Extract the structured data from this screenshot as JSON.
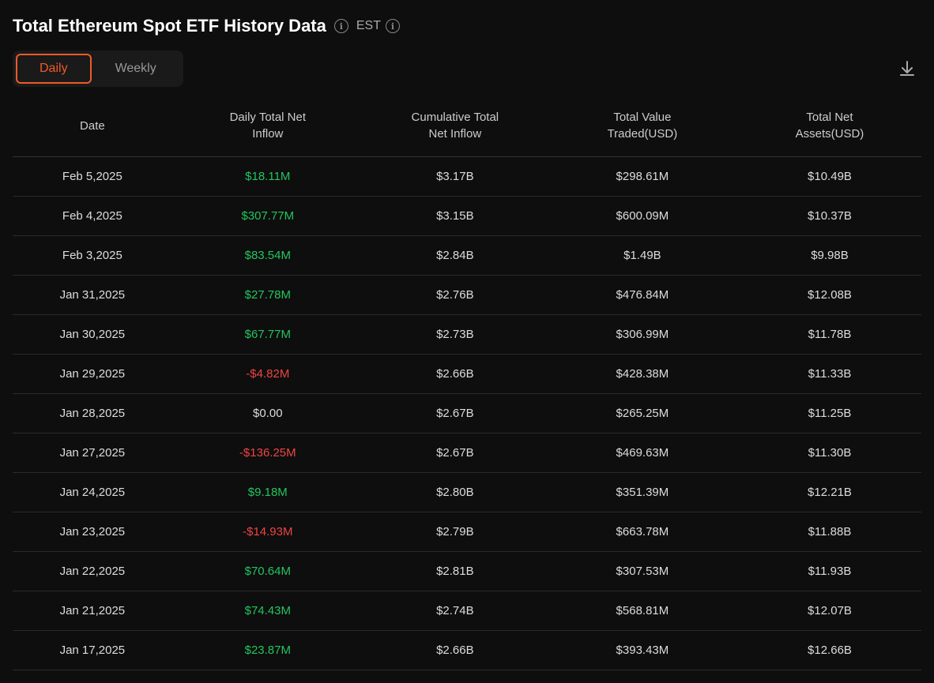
{
  "title": "Total Ethereum Spot ETF History Data",
  "timezone": "EST",
  "tabs": [
    {
      "label": "Daily",
      "active": true
    },
    {
      "label": "Weekly",
      "active": false
    }
  ],
  "columns": [
    {
      "key": "date",
      "label": "Date"
    },
    {
      "key": "daily_inflow",
      "label": "Daily Total Net\nInflow"
    },
    {
      "key": "cumulative_inflow",
      "label": "Cumulative Total\nNet Inflow"
    },
    {
      "key": "total_value_traded",
      "label": "Total Value\nTraded(USD)"
    },
    {
      "key": "total_net_assets",
      "label": "Total Net\nAssets(USD)"
    }
  ],
  "rows": [
    {
      "date": "Feb 5,2025",
      "daily_inflow": "$18.11M",
      "daily_inflow_type": "positive",
      "cumulative_inflow": "$3.17B",
      "total_value_traded": "$298.61M",
      "total_net_assets": "$10.49B"
    },
    {
      "date": "Feb 4,2025",
      "daily_inflow": "$307.77M",
      "daily_inflow_type": "positive",
      "cumulative_inflow": "$3.15B",
      "total_value_traded": "$600.09M",
      "total_net_assets": "$10.37B"
    },
    {
      "date": "Feb 3,2025",
      "daily_inflow": "$83.54M",
      "daily_inflow_type": "positive",
      "cumulative_inflow": "$2.84B",
      "total_value_traded": "$1.49B",
      "total_net_assets": "$9.98B"
    },
    {
      "date": "Jan 31,2025",
      "daily_inflow": "$27.78M",
      "daily_inflow_type": "positive",
      "cumulative_inflow": "$2.76B",
      "total_value_traded": "$476.84M",
      "total_net_assets": "$12.08B"
    },
    {
      "date": "Jan 30,2025",
      "daily_inflow": "$67.77M",
      "daily_inflow_type": "positive",
      "cumulative_inflow": "$2.73B",
      "total_value_traded": "$306.99M",
      "total_net_assets": "$11.78B"
    },
    {
      "date": "Jan 29,2025",
      "daily_inflow": "-$4.82M",
      "daily_inflow_type": "negative",
      "cumulative_inflow": "$2.66B",
      "total_value_traded": "$428.38M",
      "total_net_assets": "$11.33B"
    },
    {
      "date": "Jan 28,2025",
      "daily_inflow": "$0.00",
      "daily_inflow_type": "neutral",
      "cumulative_inflow": "$2.67B",
      "total_value_traded": "$265.25M",
      "total_net_assets": "$11.25B"
    },
    {
      "date": "Jan 27,2025",
      "daily_inflow": "-$136.25M",
      "daily_inflow_type": "negative",
      "cumulative_inflow": "$2.67B",
      "total_value_traded": "$469.63M",
      "total_net_assets": "$11.30B"
    },
    {
      "date": "Jan 24,2025",
      "daily_inflow": "$9.18M",
      "daily_inflow_type": "positive",
      "cumulative_inflow": "$2.80B",
      "total_value_traded": "$351.39M",
      "total_net_assets": "$12.21B"
    },
    {
      "date": "Jan 23,2025",
      "daily_inflow": "-$14.93M",
      "daily_inflow_type": "negative",
      "cumulative_inflow": "$2.79B",
      "total_value_traded": "$663.78M",
      "total_net_assets": "$11.88B"
    },
    {
      "date": "Jan 22,2025",
      "daily_inflow": "$70.64M",
      "daily_inflow_type": "positive",
      "cumulative_inflow": "$2.81B",
      "total_value_traded": "$307.53M",
      "total_net_assets": "$11.93B"
    },
    {
      "date": "Jan 21,2025",
      "daily_inflow": "$74.43M",
      "daily_inflow_type": "positive",
      "cumulative_inflow": "$2.74B",
      "total_value_traded": "$568.81M",
      "total_net_assets": "$12.07B"
    },
    {
      "date": "Jan 17,2025",
      "daily_inflow": "$23.87M",
      "daily_inflow_type": "positive",
      "cumulative_inflow": "$2.66B",
      "total_value_traded": "$393.43M",
      "total_net_assets": "$12.66B"
    }
  ],
  "icons": {
    "info": "ℹ",
    "download": "⬇"
  }
}
